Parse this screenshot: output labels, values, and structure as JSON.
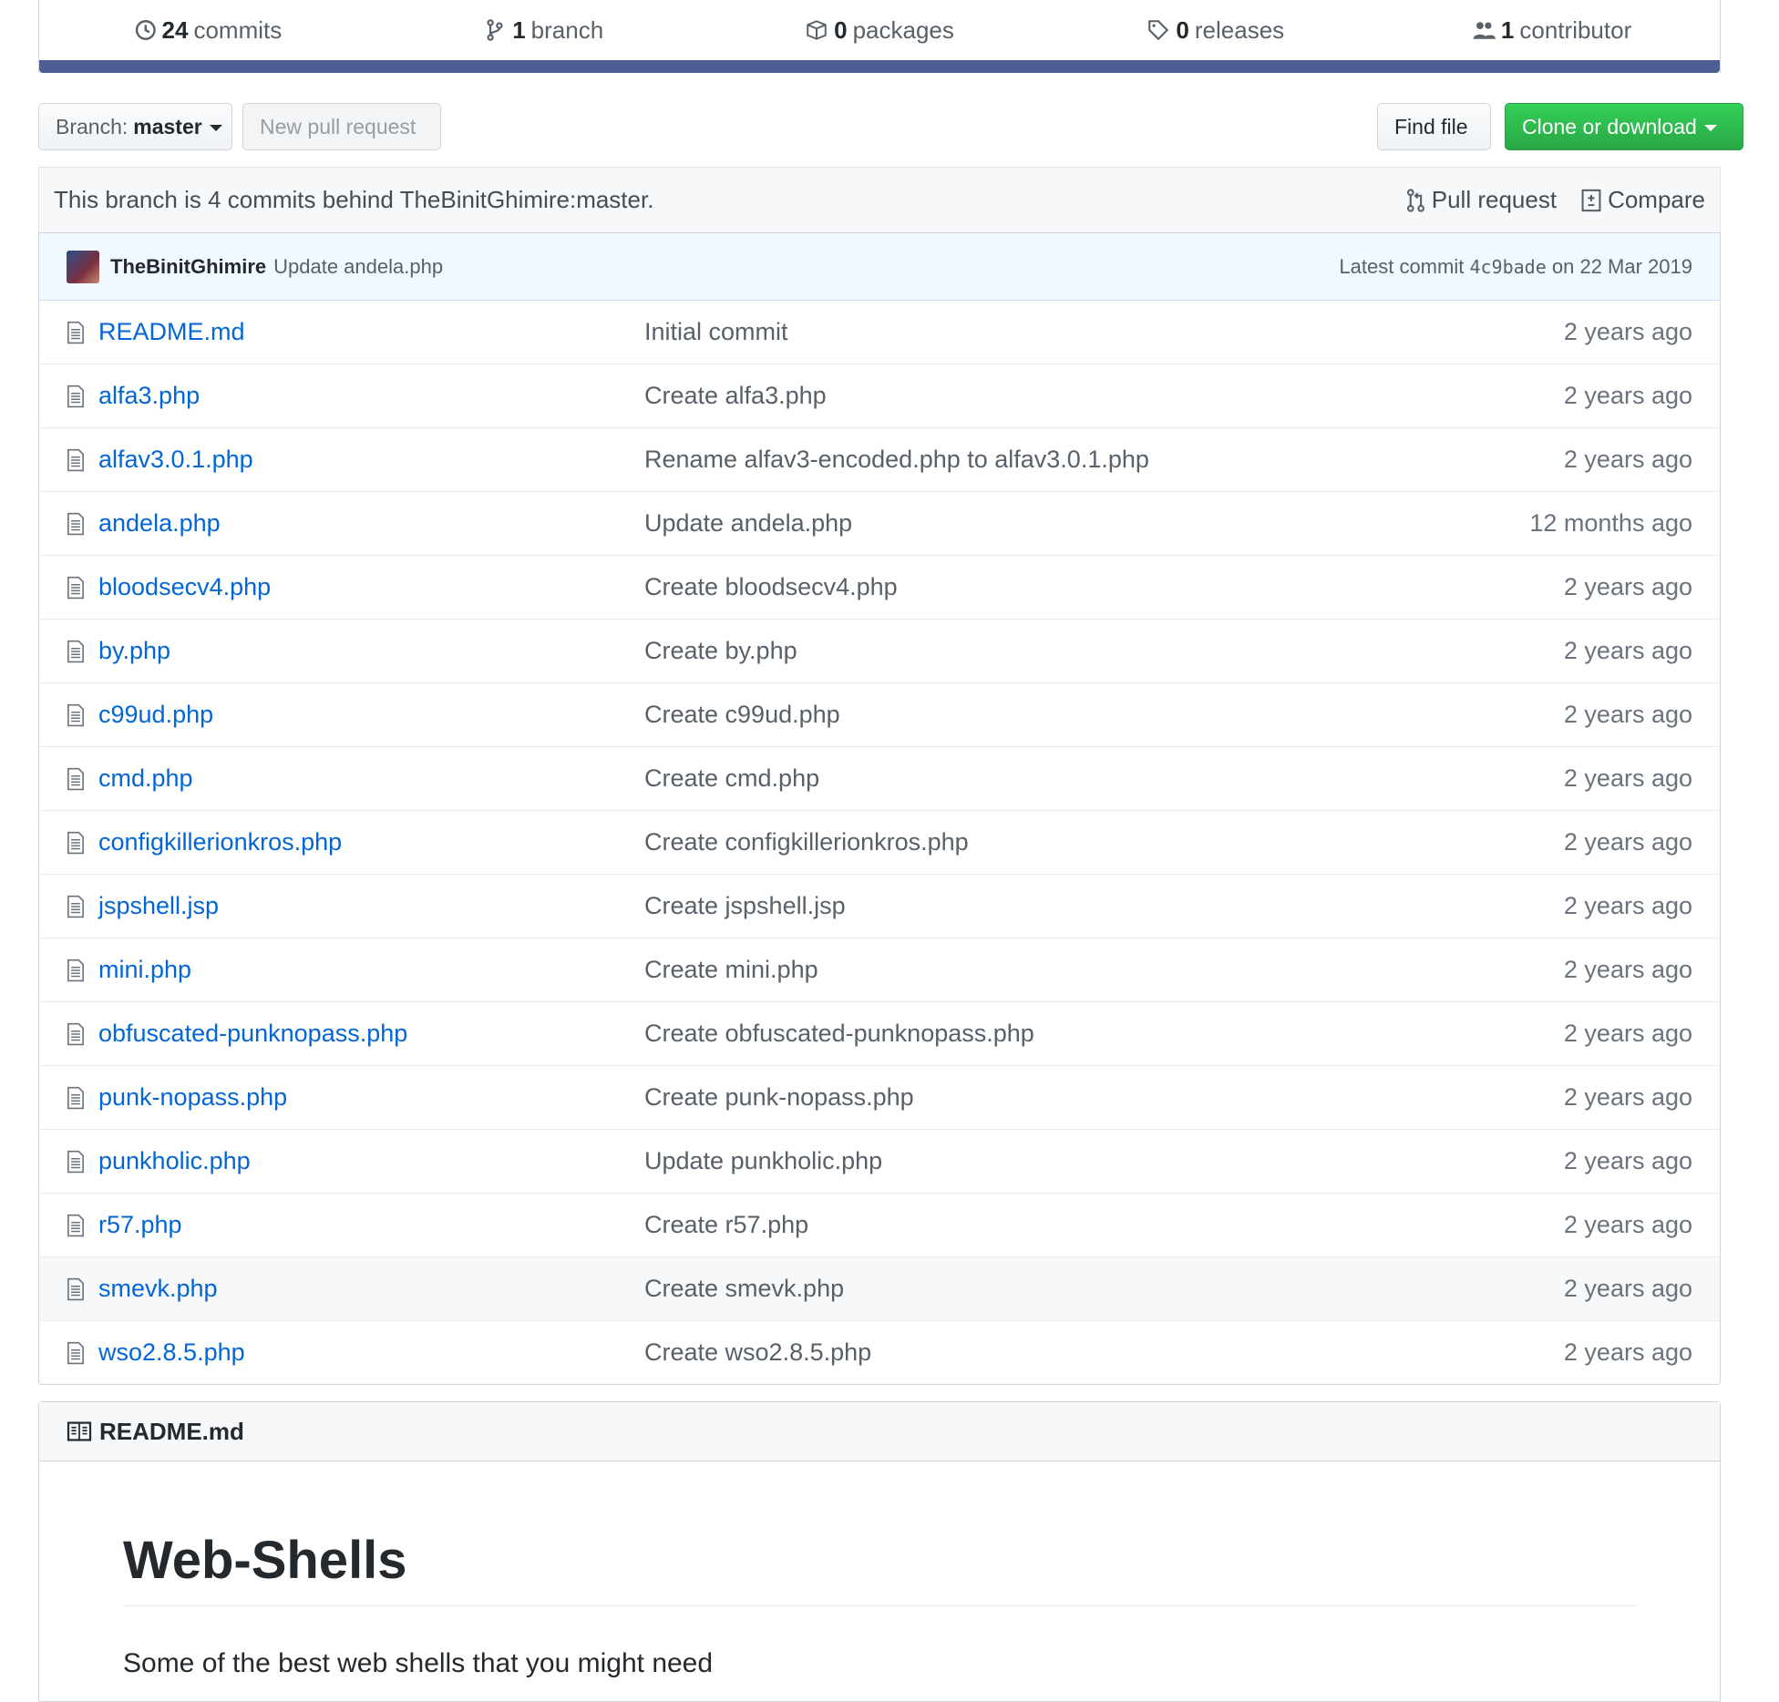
{
  "stats": {
    "commits_count": "24",
    "commits_label": "commits",
    "branches_count": "1",
    "branches_label": "branch",
    "packages_count": "0",
    "packages_label": "packages",
    "releases_count": "0",
    "releases_label": "releases",
    "contributors_count": "1",
    "contributors_label": "contributor",
    "language_bar_color": "#4f5d95"
  },
  "toolbar": {
    "branch_prefix": "Branch:",
    "branch_name": "master",
    "new_pull_request": "New pull request",
    "find_file": "Find file",
    "clone_or_download": "Clone or download"
  },
  "behind_notice": {
    "text": "This branch is 4 commits behind TheBinitGhimire:master.",
    "pull_request": "Pull request",
    "compare": "Compare"
  },
  "latest_commit": {
    "author": "TheBinitGhimire",
    "message": "Update andela.php",
    "prefix": "Latest commit",
    "sha": "4c9bade",
    "date": "on 22 Mar 2019"
  },
  "files": [
    {
      "name": "README.md",
      "message": "Initial commit",
      "age": "2 years ago"
    },
    {
      "name": "alfa3.php",
      "message": "Create alfa3.php",
      "age": "2 years ago"
    },
    {
      "name": "alfav3.0.1.php",
      "message": "Rename alfav3-encoded.php to alfav3.0.1.php",
      "age": "2 years ago"
    },
    {
      "name": "andela.php",
      "message": "Update andela.php",
      "age": "12 months ago"
    },
    {
      "name": "bloodsecv4.php",
      "message": "Create bloodsecv4.php",
      "age": "2 years ago"
    },
    {
      "name": "by.php",
      "message": "Create by.php",
      "age": "2 years ago"
    },
    {
      "name": "c99ud.php",
      "message": "Create c99ud.php",
      "age": "2 years ago"
    },
    {
      "name": "cmd.php",
      "message": "Create cmd.php",
      "age": "2 years ago"
    },
    {
      "name": "configkillerionkros.php",
      "message": "Create configkillerionkros.php",
      "age": "2 years ago"
    },
    {
      "name": "jspshell.jsp",
      "message": "Create jspshell.jsp",
      "age": "2 years ago"
    },
    {
      "name": "mini.php",
      "message": "Create mini.php",
      "age": "2 years ago"
    },
    {
      "name": "obfuscated-punknopass.php",
      "message": "Create obfuscated-punknopass.php",
      "age": "2 years ago"
    },
    {
      "name": "punk-nopass.php",
      "message": "Create punk-nopass.php",
      "age": "2 years ago"
    },
    {
      "name": "punkholic.php",
      "message": "Update punkholic.php",
      "age": "2 years ago"
    },
    {
      "name": "r57.php",
      "message": "Create r57.php",
      "age": "2 years ago"
    },
    {
      "name": "smevk.php",
      "message": "Create smevk.php",
      "age": "2 years ago"
    },
    {
      "name": "wso2.8.5.php",
      "message": "Create wso2.8.5.php",
      "age": "2 years ago"
    }
  ],
  "readme": {
    "filename": "README.md",
    "heading": "Web-Shells",
    "paragraph": "Some of the best web shells that you might need"
  }
}
